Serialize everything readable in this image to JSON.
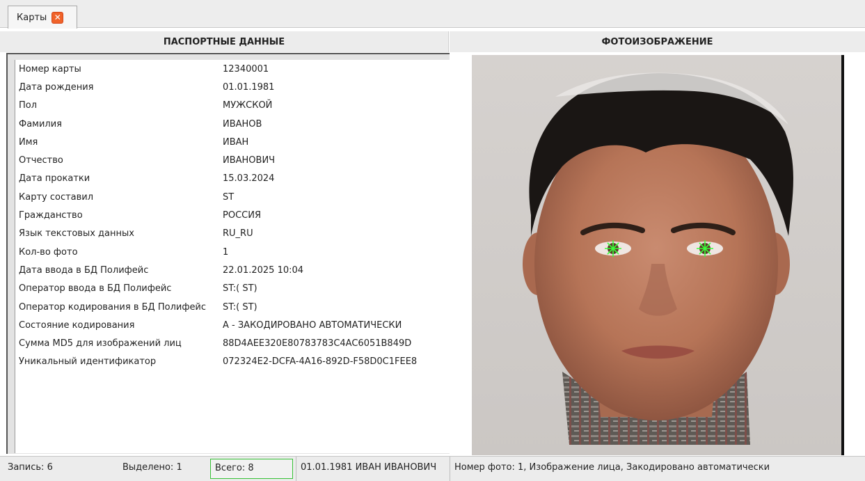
{
  "tab": {
    "label": "Карты"
  },
  "headers": {
    "passport": "ПАСПОРТНЫЕ ДАННЫЕ",
    "photo": "ФОТОИЗОБРАЖЕНИЕ"
  },
  "passport": [
    {
      "key": "Номер карты",
      "value": "12340001"
    },
    {
      "key": "Дата рождения",
      "value": "01.01.1981"
    },
    {
      "key": "Пол",
      "value": "МУЖСКОЙ"
    },
    {
      "key": "Фамилия",
      "value": "ИВАНОВ"
    },
    {
      "key": "Имя",
      "value": "ИВАН"
    },
    {
      "key": "Отчество",
      "value": "ИВАНОВИЧ"
    },
    {
      "key": "Дата прокатки",
      "value": "15.03.2024"
    },
    {
      "key": "Карту составил",
      "value": "ST"
    },
    {
      "key": "Гражданство",
      "value": "РОССИЯ"
    },
    {
      "key": "Язык текстовых данных",
      "value": "RU_RU"
    },
    {
      "key": "Кол-во фото",
      "value": "1"
    },
    {
      "key": "Дата ввода в БД Полифейс",
      "value": "22.01.2025 10:04"
    },
    {
      "key": "Оператор ввода в БД Полифейс",
      "value": "ST:( ST)"
    },
    {
      "key": "Оператор кодирования в БД Полифейс",
      "value": "ST:( ST)"
    },
    {
      "key": "Состояние кодирования",
      "value": "А - ЗАКОДИРОВАНО АВТОМАТИЧЕСКИ"
    },
    {
      "key": "Сумма MD5 для изображений лиц",
      "value": "88D4AEE320E80783783C4AC6051B849D"
    },
    {
      "key": "Уникальный идентификатор",
      "value": "072324E2-DCFA-4A16-892D-F58D0C1FEE8"
    }
  ],
  "status": {
    "record": "Запись: 6",
    "selected": "Выделено: 1",
    "total": "Всего: 8",
    "person": "01.01.1981  ИВАН ИВАНОВИЧ",
    "photo_info": "Номер фото: 1, Изображение лица, Закодировано автоматически"
  },
  "colors": {
    "eye_marker": "#39ff39",
    "close_button": "#f0632a",
    "total_border": "#35c135"
  },
  "icons": [
    "close-icon",
    "eye-marker-icon"
  ]
}
